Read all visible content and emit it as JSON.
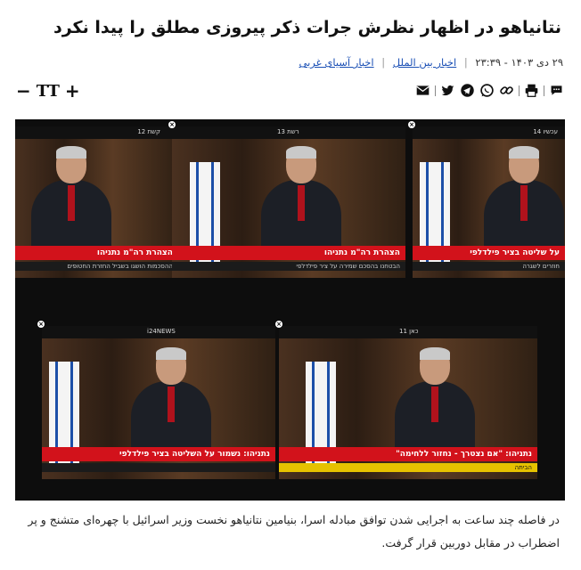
{
  "article": {
    "title": "نتانیاهو در اظهار نظرش جرات ذکر پیروزی مطلق را پیدا نکرد",
    "date": "۲۹ دی ۱۴۰۳ - ۲۳:۳۹",
    "categories": [
      "اخبار بین الملل",
      "اخبار آسیای غربی"
    ],
    "caption": "در فاصله چند ساعت به اجرایی شدن توافق مبادله اسرا، بنیامین نتانیاهو نخست وزیر اسرائیل با چهره‌ای متشنج و پر اضطراب در مقابل دوربین قرار گرفت."
  },
  "share": {
    "icons": [
      "comment-icon",
      "print-icon",
      "link-icon",
      "whatsapp-icon",
      "telegram-icon",
      "twitter-icon",
      "email-icon"
    ]
  },
  "font_control": {
    "minus": "−",
    "label": "TT",
    "plus": "+"
  },
  "photo": {
    "frames": [
      {
        "channel": "קשת 12",
        "ticker": "הצהרת רה\"מ נתניהו",
        "subticker": "ההסכמות הושגו בשביל החזרת החטופים"
      },
      {
        "channel": "רשת 13",
        "ticker": "הצהרת רה\"מ נתניהו",
        "subticker": "הבטחנו בהסכם שמירה על ציר פילדלפי"
      },
      {
        "channel": "עכשיו 14",
        "ticker": "על שליטה בציר פילדלפי",
        "subticker": "חוזרים לשגרה"
      },
      {
        "channel": "i24NEWS",
        "ticker": "נתניהו: נשמור על השליטה בציר פילדלפי",
        "subticker": ""
      },
      {
        "channel": "כאן 11",
        "ticker": "נתניהו: \"אם נצטרך - נחזור ללחימה\"",
        "subticker": "הביתה"
      }
    ]
  },
  "colors": {
    "accent_link": "#1a4fb5",
    "ticker_red": "#d2121b"
  }
}
